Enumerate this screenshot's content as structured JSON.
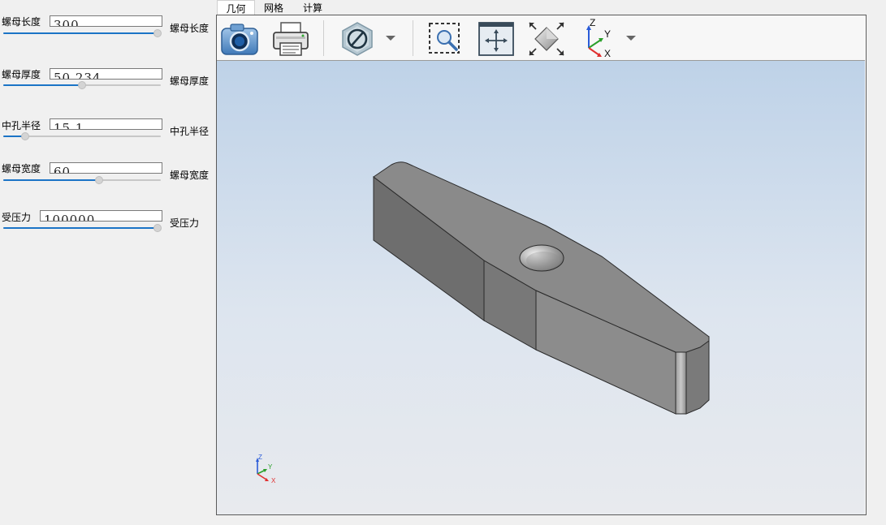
{
  "params": [
    {
      "label": "螺母长度",
      "value": "300",
      "suffix": "螺母长度",
      "slider_fraction": 0.98
    },
    {
      "label": "螺母厚度",
      "value": "50.234",
      "suffix": "螺母厚度",
      "slider_fraction": 0.5
    },
    {
      "label": "中孔半径",
      "value": "15.1",
      "suffix": "中孔半径",
      "slider_fraction": 0.14
    },
    {
      "label": "螺母宽度",
      "value": "60",
      "suffix": "螺母宽度",
      "slider_fraction": 0.61
    },
    {
      "label": "受压力",
      "value": "100000",
      "suffix": "受压力",
      "slider_fraction": 0.98
    }
  ],
  "tabs": [
    {
      "label": "几何",
      "active": true
    },
    {
      "label": "网格",
      "active": false
    },
    {
      "label": "计算",
      "active": false
    }
  ],
  "toolbar": {
    "icons": [
      "camera-icon",
      "print-icon",
      "display-mode-icon",
      "zoom-window-icon",
      "pan-icon",
      "fit-all-icon",
      "axes-view-icon"
    ],
    "axes_labels": {
      "z": "Z",
      "y": "Y",
      "x": "X"
    }
  },
  "triad": {
    "z": "Z",
    "y": "Y",
    "x": "X"
  },
  "colors": {
    "slider_fill": "#1b74c6",
    "model_gray": "#7d7d7d",
    "background_top": "#bed2e8",
    "background_bottom": "#e8eaee",
    "axis_x": "#e03030",
    "axis_y": "#2ba02b",
    "axis_z": "#2a5bd8"
  }
}
